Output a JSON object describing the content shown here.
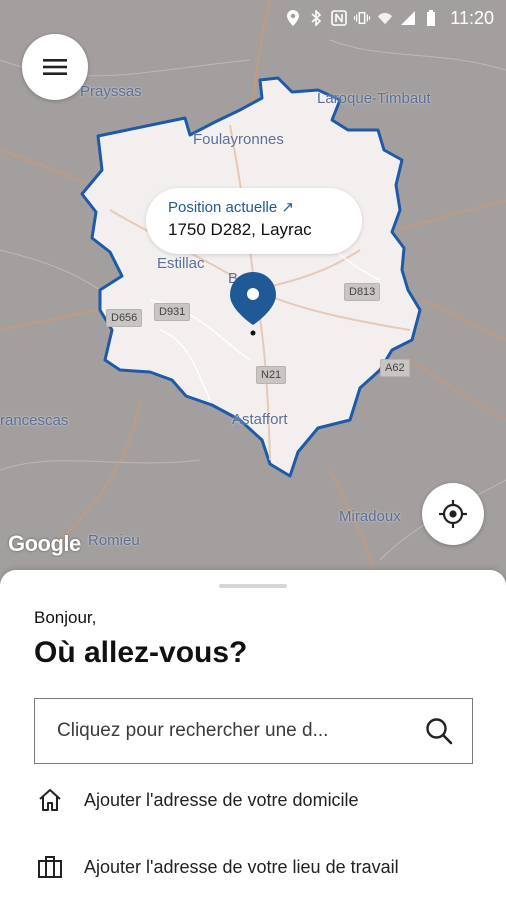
{
  "status_bar": {
    "time": "11:20",
    "icons": [
      "location-icon",
      "bluetooth-icon",
      "nfc-icon",
      "vibrate-icon",
      "wifi-icon",
      "signal-icon",
      "battery-icon"
    ]
  },
  "map": {
    "towns": {
      "prayssas": "Prayssas",
      "laroque": "Laroque-Timbaut",
      "foulayronnes": "Foulayronnes",
      "estillac": "Estillac",
      "astaffort": "Astaffort",
      "francescas": "rancescas",
      "miradoux": "Miradoux",
      "romieu": "Romieu",
      "b": "B"
    },
    "roads": {
      "d931": "D931",
      "d656": "D656",
      "d813": "D813",
      "n21": "N21",
      "a62": "A62"
    },
    "position_link": "Position actuelle ↗",
    "position_address": "1750 D282, Layrac",
    "attribution": "Google",
    "colors": {
      "zone_outline": "#1f5aa8",
      "pin": "#1f5a96",
      "zone_fill": "#f3efee"
    }
  },
  "sheet": {
    "greeting": "Bonjour,",
    "title": "Où allez-vous?",
    "search_placeholder": "Cliquez pour rechercher une d...",
    "actions": [
      {
        "label": "Ajouter l'adresse de votre domicile",
        "icon": "home-icon"
      },
      {
        "label": "Ajouter l'adresse de votre lieu de travail",
        "icon": "briefcase-icon"
      }
    ]
  }
}
